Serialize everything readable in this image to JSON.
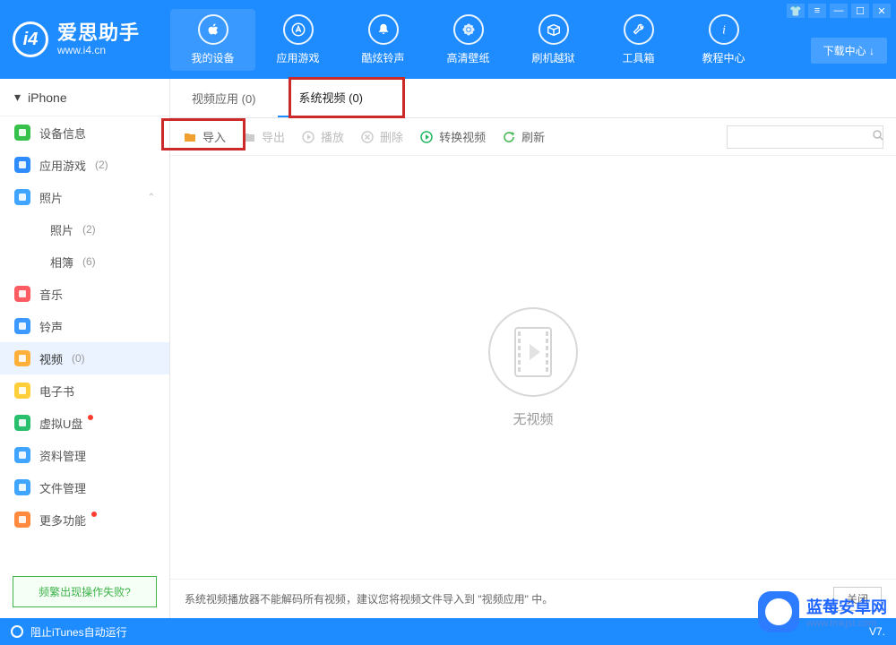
{
  "brand": {
    "name_cn": "爱思助手",
    "name_en": "www.i4.cn",
    "logo_letter": "i4"
  },
  "window_ctrls": {
    "shirt": "👕",
    "menu": "≡",
    "min": "—",
    "max": "☐",
    "close": "✕"
  },
  "download_center": "下载中心 ↓",
  "topnav": [
    {
      "label": "我的设备",
      "icon": "apple",
      "active": true
    },
    {
      "label": "应用游戏",
      "icon": "appstore",
      "active": false
    },
    {
      "label": "酷炫铃声",
      "icon": "bell",
      "active": false
    },
    {
      "label": "高清壁纸",
      "icon": "flower",
      "active": false
    },
    {
      "label": "刷机越狱",
      "icon": "box",
      "active": false
    },
    {
      "label": "工具箱",
      "icon": "wrench",
      "active": false
    },
    {
      "label": "教程中心",
      "icon": "info",
      "active": false
    }
  ],
  "device_selector": "iPhone",
  "sidebar": [
    {
      "label": "设备信息",
      "count": "",
      "color": "#36c24a"
    },
    {
      "label": "应用游戏",
      "count": "(2)",
      "color": "#2f8cff"
    },
    {
      "label": "照片",
      "count": "",
      "color": "#3fa5ff",
      "expandable": true
    },
    {
      "label": "照片",
      "count": "(2)",
      "sub": true
    },
    {
      "label": "相簿",
      "count": "(6)",
      "sub": true
    },
    {
      "label": "音乐",
      "count": "",
      "color": "#ff5b62"
    },
    {
      "label": "铃声",
      "count": "",
      "color": "#3c99ff"
    },
    {
      "label": "视频",
      "count": "(0)",
      "color": "#ffb03a",
      "selected": true
    },
    {
      "label": "电子书",
      "count": "",
      "color": "#ffcf3a"
    },
    {
      "label": "虚拟U盘",
      "count": "",
      "color": "#29c06d",
      "badge": true
    },
    {
      "label": "资料管理",
      "count": "",
      "color": "#3fa5ff"
    },
    {
      "label": "文件管理",
      "count": "",
      "color": "#3fa5ff"
    },
    {
      "label": "更多功能",
      "count": "",
      "color": "#ff8a3d",
      "badge": true
    }
  ],
  "help_link": "频繁出现操作失败?",
  "tabs": [
    {
      "label": "视频应用 (0)",
      "active": false
    },
    {
      "label": "系统视频 (0)",
      "active": true
    }
  ],
  "toolbar": {
    "import": "导入",
    "export": "导出",
    "play": "播放",
    "delete": "删除",
    "convert": "转换视频",
    "refresh": "刷新"
  },
  "search_placeholder": "",
  "empty_state": "无视频",
  "hint_text": "系统视频播放器不能解码所有视频，建议您将视频文件导入到 \"视频应用\" 中。",
  "hint_close": "关闭",
  "footer": {
    "left": "阻止iTunes自动运行",
    "right": "V7."
  },
  "watermark": {
    "title": "蓝莓安卓网",
    "sub": "www.lmkjst.com"
  }
}
